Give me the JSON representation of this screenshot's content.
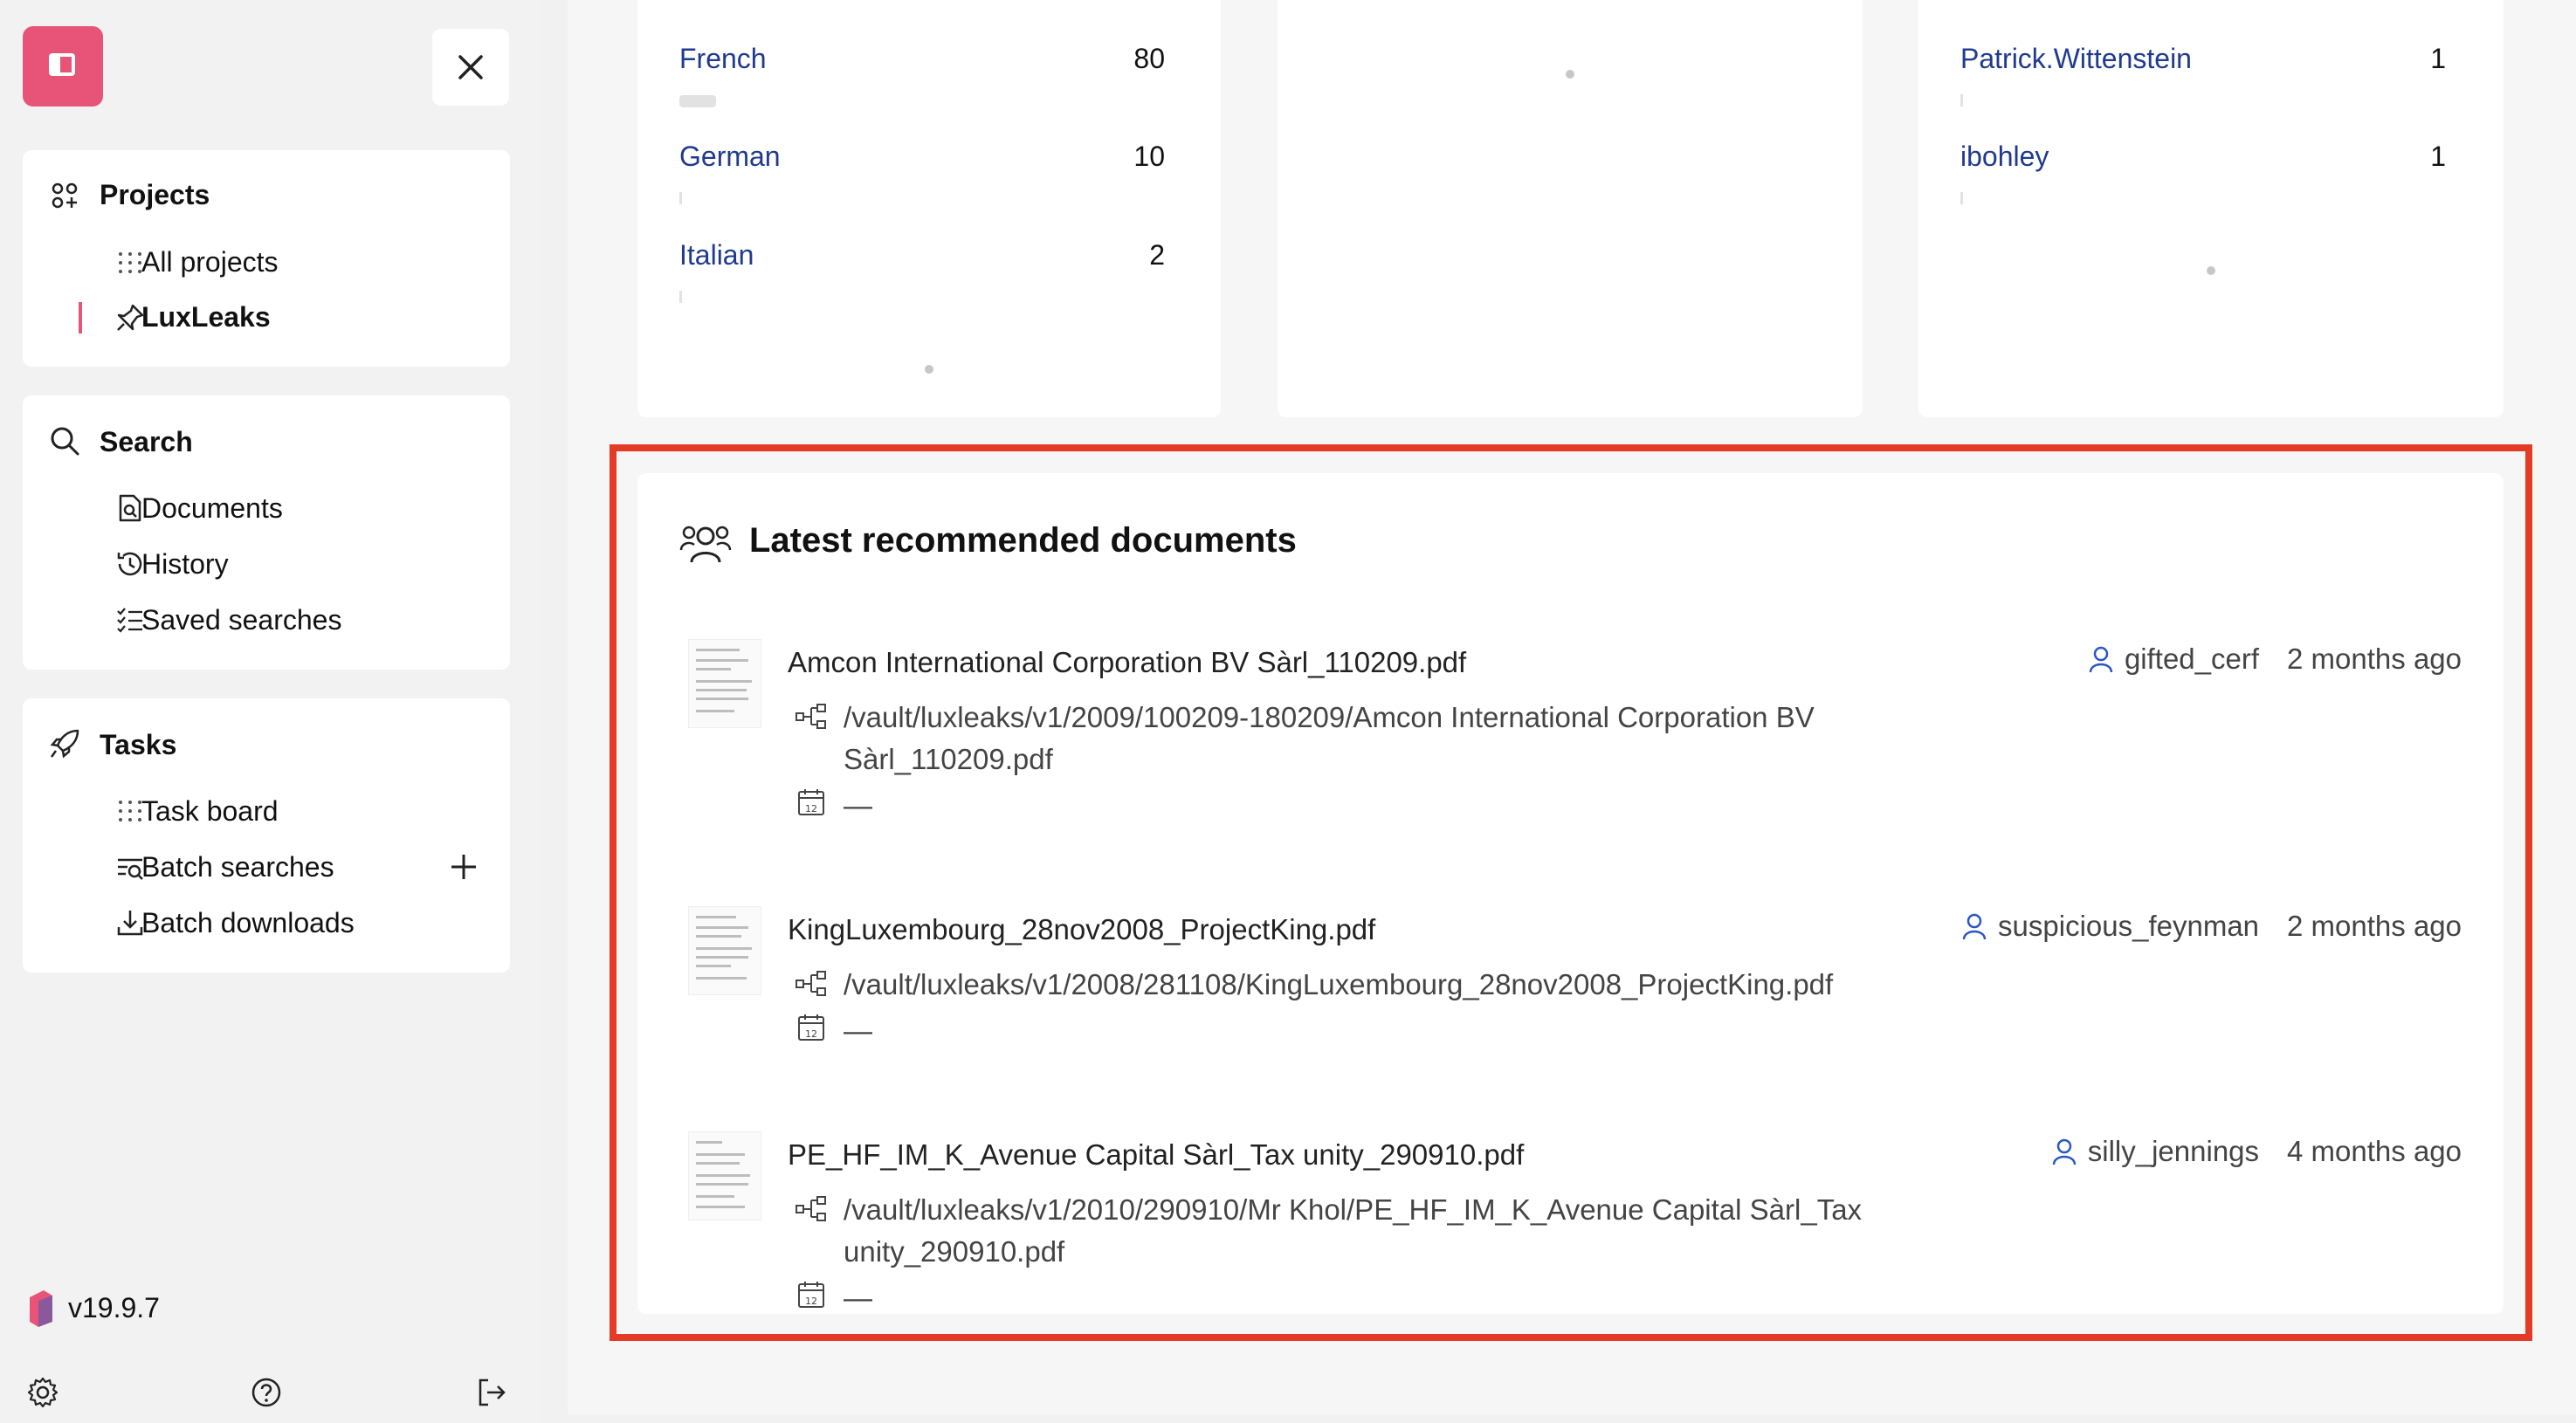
{
  "sidebar": {
    "projects": {
      "title": "Projects",
      "items": [
        {
          "label": "All projects",
          "icon": "dots-grid-icon"
        },
        {
          "label": "LuxLeaks",
          "icon": "pin-icon",
          "active": true
        }
      ]
    },
    "search": {
      "title": "Search",
      "items": [
        {
          "label": "Documents",
          "icon": "document-search-icon"
        },
        {
          "label": "History",
          "icon": "history-icon"
        },
        {
          "label": "Saved searches",
          "icon": "list-check-icon"
        }
      ]
    },
    "tasks": {
      "title": "Tasks",
      "items": [
        {
          "label": "Task board",
          "icon": "dots-grid-icon"
        },
        {
          "label": "Batch searches",
          "icon": "batch-search-icon"
        },
        {
          "label": "Batch downloads",
          "icon": "download-icon"
        }
      ]
    },
    "version": "v19.9.7",
    "accent": "#e85478"
  },
  "languages": [
    {
      "label": "French",
      "count": "80",
      "fraction": 0.0667
    },
    {
      "label": "German",
      "count": "10",
      "fraction": 0.008
    },
    {
      "label": "Italian",
      "count": "2",
      "fraction": 0.002
    }
  ],
  "contributors": [
    {
      "label": "Patrick.Wittenstein",
      "count": "1"
    },
    {
      "label": "ibohley",
      "count": "1"
    }
  ],
  "recommended": {
    "title": "Latest recommended documents",
    "documents": [
      {
        "name": "Amcon International Corporation BV Sàrl_110209.pdf",
        "path": "/vault/luxleaks/v1/2009/100209-180209/Amcon International Corporation BV Sàrl_110209.pdf",
        "date": "—",
        "user": "gifted_cerf",
        "time": "2 months ago"
      },
      {
        "name": "KingLuxembourg_28nov2008_ProjectKing.pdf",
        "path": "/vault/luxleaks/v1/2008/281108/KingLuxembourg_28nov2008_ProjectKing.pdf",
        "date": "—",
        "user": "suspicious_feynman",
        "time": "2 months ago"
      },
      {
        "name": "PE_HF_IM_K_Avenue Capital Sàrl_Tax unity_290910.pdf",
        "path": "/vault/luxleaks/v1/2010/290910/Mr Khol/PE_HF_IM_K_Avenue Capital Sàrl_Tax unity_290910.pdf",
        "date": "—",
        "user": "silly_jennings",
        "time": "4 months ago"
      }
    ]
  }
}
